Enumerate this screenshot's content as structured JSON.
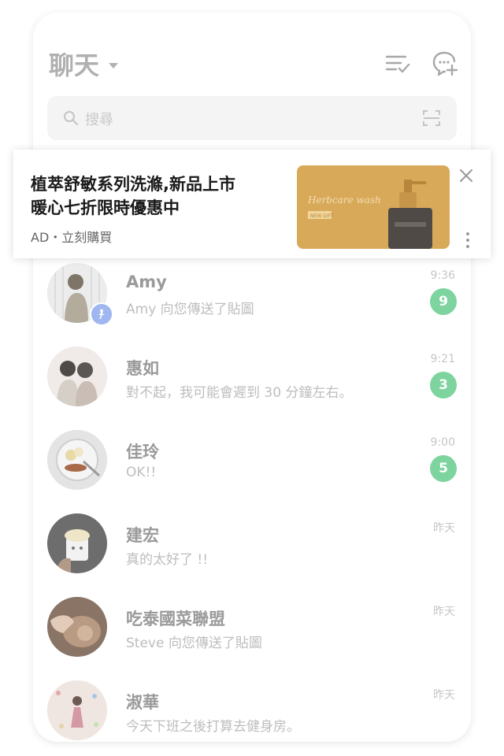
{
  "header": {
    "title": "聊天"
  },
  "search": {
    "placeholder": "搜尋"
  },
  "ad": {
    "line1": "植萃舒敏系列洗滌,新品上市",
    "line2": "暖心七折限時優惠中",
    "sub": "AD・立刻購買",
    "image_script_text": "Herbcare wash",
    "image_tag_text": "NEW GIFT"
  },
  "chats": [
    {
      "name": "Amy",
      "message": "Amy 向您傳送了貼圖",
      "time": "9:36",
      "unread": "9",
      "pinned": true
    },
    {
      "name": "惠如",
      "message": "對不起，我可能會遲到 30 分鐘左右。",
      "time": "9:21",
      "unread": "3",
      "pinned": false
    },
    {
      "name": "佳玲",
      "message": "OK!!",
      "time": "9:00",
      "unread": "5",
      "pinned": false
    },
    {
      "name": "建宏",
      "message": "真的太好了 !!",
      "time": "昨天",
      "unread": null,
      "pinned": false
    },
    {
      "name": "吃泰國菜聯盟",
      "message": "Steve 向您傳送了貼圖",
      "time": "昨天",
      "unread": null,
      "pinned": false
    },
    {
      "name": "淑華",
      "message": "今天下班之後打算去健身房。",
      "time": "昨天",
      "unread": null,
      "pinned": false
    }
  ],
  "colors": {
    "unread_badge": "#7dd49e",
    "pin_badge": "#9fb6f0",
    "ad_image_bg": "#d9a95a"
  }
}
